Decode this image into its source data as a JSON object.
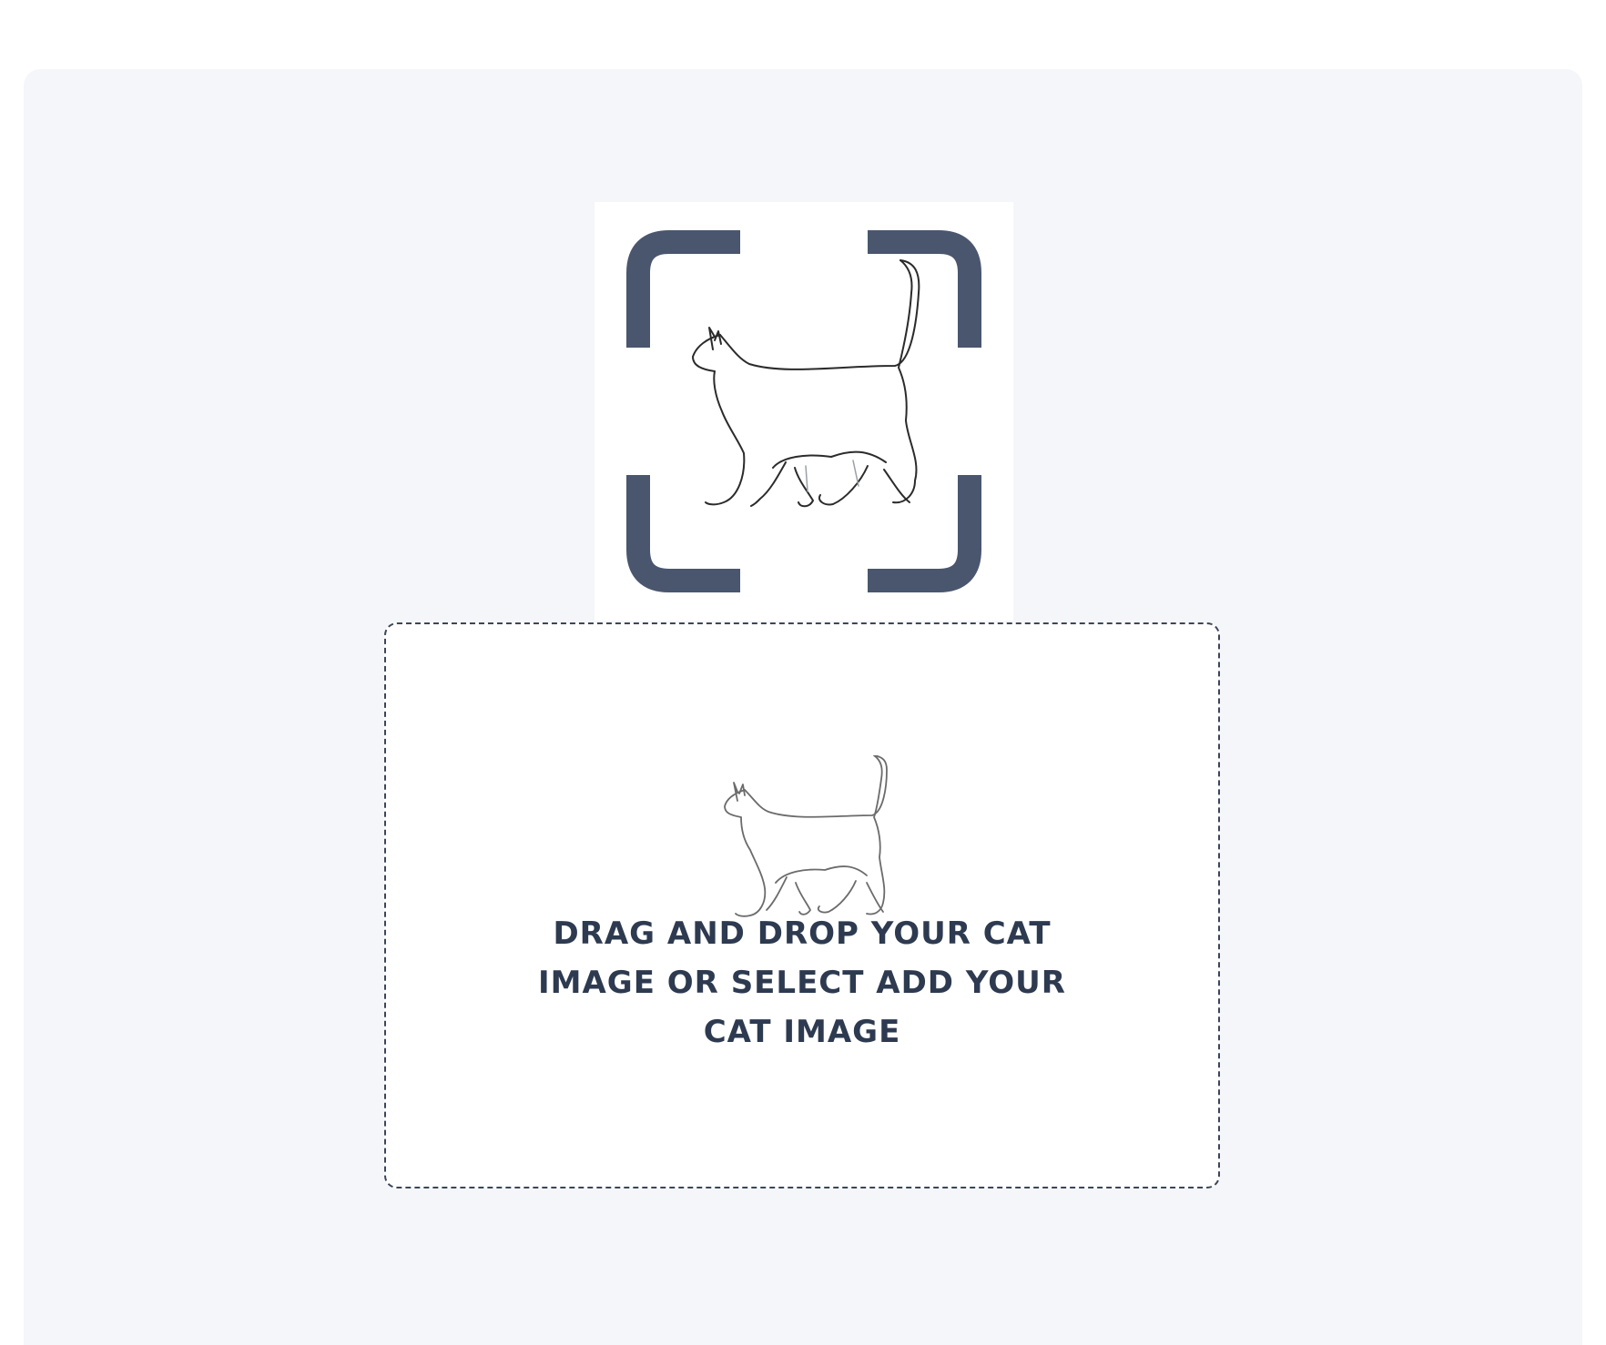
{
  "logo": {
    "icon": "cat-scan-icon",
    "bracket_color": "#4a566e"
  },
  "upload": {
    "icon": "cat-outline-icon",
    "prompt": "DRAG AND DROP YOUR CAT IMAGE OR SELECT ADD YOUR CAT IMAGE",
    "border_color": "#3b4658",
    "text_color": "#2d3a50"
  }
}
